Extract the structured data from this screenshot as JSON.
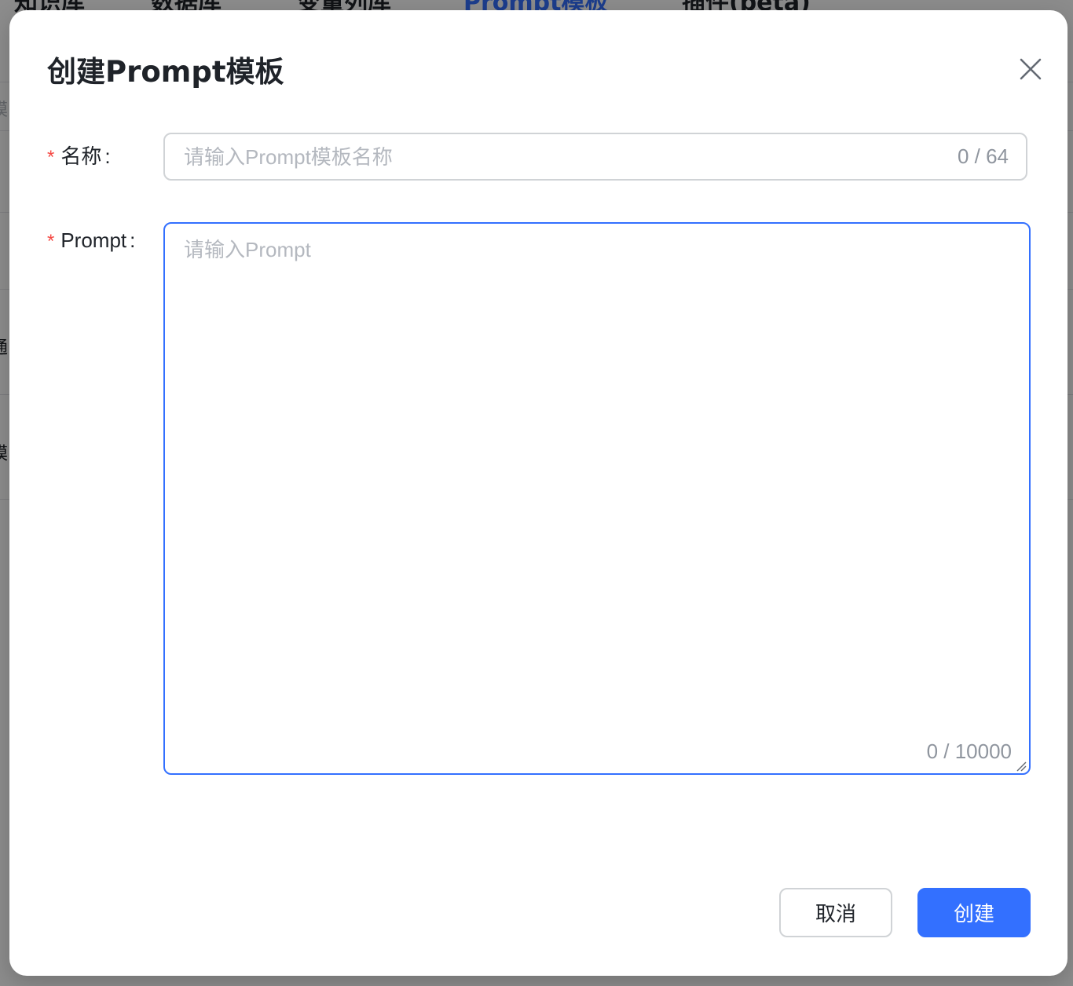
{
  "background": {
    "tabs": [
      {
        "label": "知识库",
        "active": false
      },
      {
        "label": "数据库",
        "active": false
      },
      {
        "label": "变量列库",
        "active": false
      },
      {
        "label": "Prompt模板",
        "active": true
      },
      {
        "label": "插件(beta)",
        "active": false
      }
    ],
    "fragments": [
      "模",
      "通",
      "模"
    ]
  },
  "modal": {
    "title": "创建Prompt模板",
    "close_icon": "close-icon"
  },
  "form": {
    "name": {
      "required_mark": "*",
      "label": "名称",
      "colon": ":",
      "value": "",
      "placeholder": "请输入Prompt模板名称",
      "counter": "0 / 64"
    },
    "prompt": {
      "required_mark": "*",
      "label": "Prompt",
      "colon": ":",
      "value": "",
      "placeholder": "请输入Prompt",
      "counter": "0 / 10000"
    }
  },
  "footer": {
    "cancel_label": "取消",
    "create_label": "创建"
  },
  "colors": {
    "primary": "#3370ff",
    "required": "#f54a45",
    "placeholder": "#b4b8bf"
  }
}
